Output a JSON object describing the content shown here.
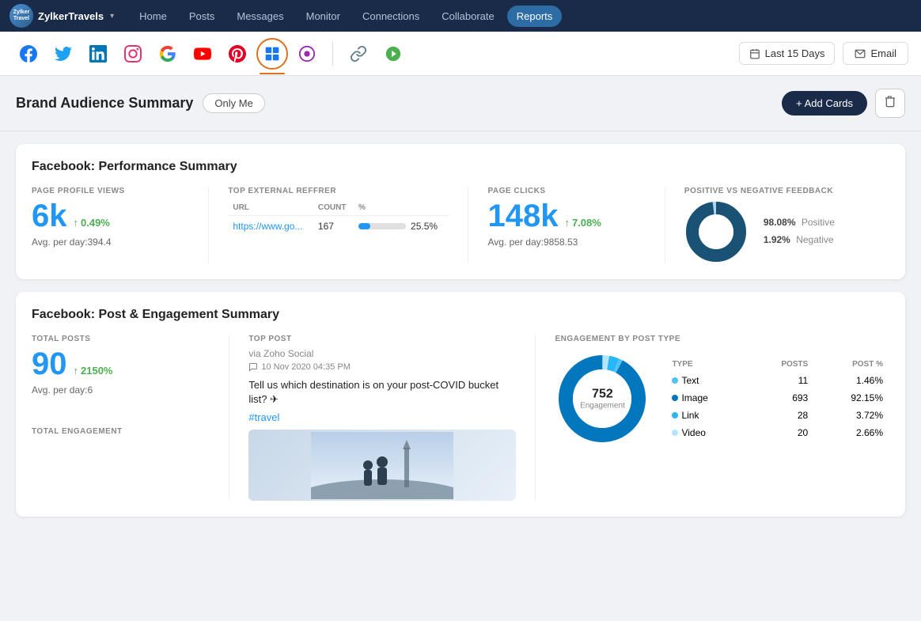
{
  "nav": {
    "brand_name": "ZylkerTravels",
    "brand_initials": "Zylker\nTravel",
    "items": [
      "Home",
      "Posts",
      "Messages",
      "Monitor",
      "Connections",
      "Collaborate",
      "Reports"
    ],
    "active_item": "Reports"
  },
  "social_bar": {
    "icons": [
      {
        "name": "facebook",
        "symbol": "f",
        "color": "#1877f2",
        "active": false
      },
      {
        "name": "twitter",
        "symbol": "🐦",
        "color": "#1da1f2",
        "active": false
      },
      {
        "name": "linkedin",
        "symbol": "in",
        "color": "#0077b5",
        "active": false
      },
      {
        "name": "instagram",
        "symbol": "📷",
        "color": "#e1306c",
        "active": false
      },
      {
        "name": "google",
        "symbol": "G",
        "color": "#4285f4",
        "active": false
      },
      {
        "name": "youtube",
        "symbol": "▶",
        "color": "#ff0000",
        "active": false
      },
      {
        "name": "pinterest",
        "symbol": "P",
        "color": "#e60023",
        "active": false
      },
      {
        "name": "facebook-pages",
        "symbol": "⊞",
        "color": "#1877f2",
        "active": true
      },
      {
        "name": "extra1",
        "symbol": "◉",
        "color": "#9c27b0",
        "active": false
      },
      {
        "name": "link1",
        "symbol": "∞",
        "color": "#607d8b",
        "active": false
      },
      {
        "name": "link2",
        "symbol": "◈",
        "color": "#4caf50",
        "active": false
      }
    ],
    "date_range": "Last 15 Days",
    "email_label": "Email"
  },
  "page_header": {
    "title": "Brand Audience Summary",
    "visibility": "Only Me",
    "add_cards_label": "+ Add Cards"
  },
  "performance_summary": {
    "section_title": "Facebook: Performance Summary",
    "page_profile_views": {
      "label": "PAGE PROFILE VIEWS",
      "value": "6k",
      "change": "0.49%",
      "change_dir": "up",
      "avg_label": "Avg. per day:",
      "avg_value": "394.4"
    },
    "top_external_referrer": {
      "label": "TOP EXTERNAL REFFRER",
      "columns": [
        "URL",
        "COUNT",
        "%"
      ],
      "rows": [
        {
          "url": "https://www.go...",
          "count": "167",
          "percent": "25.5%",
          "bar_pct": 25
        }
      ]
    },
    "page_clicks": {
      "label": "PAGE CLICKS",
      "value": "148k",
      "change": "7.08%",
      "change_dir": "up",
      "avg_label": "Avg. per day:",
      "avg_value": "9858.53"
    },
    "feedback": {
      "label": "POSITIVE VS NEGATIVE FEEDBACK",
      "positive_pct": "98.08%",
      "positive_label": "Positive",
      "negative_pct": "1.92%",
      "negative_label": "Negative",
      "positive_color": "#1a5276",
      "negative_color": "#aed6f1"
    }
  },
  "post_engagement": {
    "section_title": "Facebook: Post & Engagement Summary",
    "total_posts": {
      "label": "TOTAL POSTS",
      "value": "90",
      "change": "2150%",
      "change_dir": "up",
      "avg_label": "Avg. per day:",
      "avg_value": "6"
    },
    "top_post": {
      "label": "TOP POST",
      "source": "via Zoho Social",
      "date": "10 Nov 2020 04:35 PM",
      "text": "Tell us which destination is on your post-COVID bucket list? ✈",
      "hashtag": "#travel"
    },
    "engagement_by_post_type": {
      "label": "ENGAGEMENT BY POST TYPE",
      "total": "752",
      "center_label": "Engagement",
      "columns": [
        "TYPE",
        "POSTS",
        "POST %"
      ],
      "rows": [
        {
          "type": "Text",
          "color": "#4fc3f7",
          "posts": 11,
          "pct": "1.46%"
        },
        {
          "type": "Image",
          "color": "#0277bd",
          "posts": 693,
          "pct": "92.15%"
        },
        {
          "type": "Link",
          "color": "#29b6f6",
          "posts": 28,
          "pct": "3.72%"
        },
        {
          "type": "Video",
          "color": "#b3e5fc",
          "posts": 20,
          "pct": "2.66%"
        }
      ]
    },
    "total_engagement": {
      "label": "TOTAL ENGAGEMENT"
    }
  }
}
